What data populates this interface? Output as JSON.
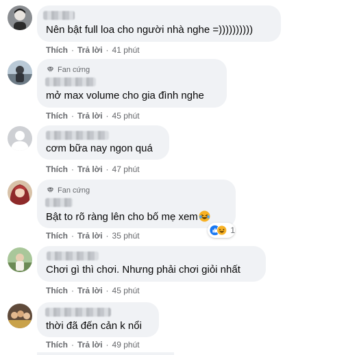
{
  "comments": [
    {
      "badge": "",
      "text": "Nên bật full loa cho người nhà nghe =))))))))))",
      "like": "Thích",
      "reply": "Trả lời",
      "time": "41 phút",
      "avatar_icon": "user-photo"
    },
    {
      "badge": "Fan cứng",
      "text": "mở max volume cho gia đình nghe",
      "like": "Thích",
      "reply": "Trả lời",
      "time": "45 phút",
      "avatar_icon": "user-photo"
    },
    {
      "badge": "",
      "text": "cơm bữa nay ngon quá",
      "like": "Thích",
      "reply": "Trả lời",
      "time": "47 phút",
      "avatar_icon": "default-avatar"
    },
    {
      "badge": "Fan cứng",
      "text": "Bật to rõ ràng lên cho bố mẹ xem",
      "like": "Thích",
      "reply": "Trả lời",
      "time": "35 phút",
      "avatar_icon": "user-photo",
      "emoji": "laughing-tears-emoji",
      "reactions": {
        "icons": [
          "like-reaction-icon",
          "haha-reaction-icon"
        ],
        "count": "1"
      }
    },
    {
      "badge": "",
      "text": "Chơi gì thì chơi. Nhưng phải chơi giỏi nhất",
      "like": "Thích",
      "reply": "Trả lời",
      "time": "45 phút",
      "avatar_icon": "user-photo"
    },
    {
      "badge": "",
      "text": "thời đã đến cản k nổi",
      "like": "Thích",
      "reply": "Trả lời",
      "time": "49 phút",
      "avatar_icon": "user-photo"
    }
  ],
  "colors": {
    "bubble": "#f0f2f5",
    "text": "#050505",
    "meta": "#65676b",
    "like_blue": "#1877f2",
    "haha_yellow": "#f7b125"
  }
}
